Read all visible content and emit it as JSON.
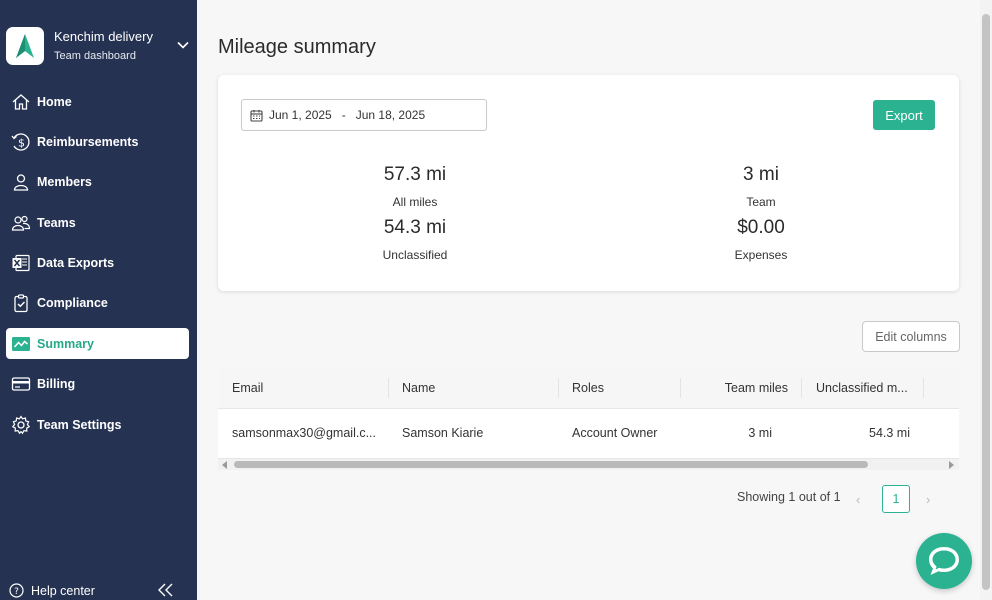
{
  "sidebar": {
    "brand": {
      "name": "Kenchim delivery",
      "subtitle": "Team dashboard"
    },
    "items": [
      {
        "label": "Home",
        "icon": "home-icon"
      },
      {
        "label": "Reimbursements",
        "icon": "dollar-icon"
      },
      {
        "label": "Members",
        "icon": "person-icon"
      },
      {
        "label": "Teams",
        "icon": "people-icon"
      },
      {
        "label": "Data Exports",
        "icon": "excel-icon"
      },
      {
        "label": "Compliance",
        "icon": "clipboard-check-icon"
      },
      {
        "label": "Summary",
        "icon": "chart-line-icon",
        "active": true
      },
      {
        "label": "Billing",
        "icon": "credit-card-icon"
      },
      {
        "label": "Team Settings",
        "icon": "gear-icon"
      }
    ],
    "help_label": "Help center"
  },
  "page": {
    "title": "Mileage summary"
  },
  "filters": {
    "date_start": "Jun 1, 2025",
    "date_sep": "-",
    "date_end": "Jun 18, 2025"
  },
  "actions": {
    "export_label": "Export",
    "edit_columns_label": "Edit columns"
  },
  "stats": {
    "all_miles": {
      "value": "57.3 mi",
      "label": "All miles"
    },
    "team": {
      "value": "3 mi",
      "label": "Team"
    },
    "unclassified": {
      "value": "54.3 mi",
      "label": "Unclassified"
    },
    "expenses": {
      "value": "$0.00",
      "label": "Expenses"
    }
  },
  "table": {
    "columns": [
      "Email",
      "Name",
      "Roles",
      "Team miles",
      "Unclassified m..."
    ],
    "rows": [
      {
        "email": "samsonmax30@gmail.c...",
        "name": "Samson Kiarie",
        "role": "Account Owner",
        "team_miles": "3 mi",
        "unclassified": "54.3 mi"
      }
    ]
  },
  "pagination": {
    "text": "Showing 1 out of 1",
    "current": "1",
    "prev": "‹",
    "next": "›"
  },
  "colors": {
    "sidebar": "#253252",
    "accent": "#2bb391"
  }
}
